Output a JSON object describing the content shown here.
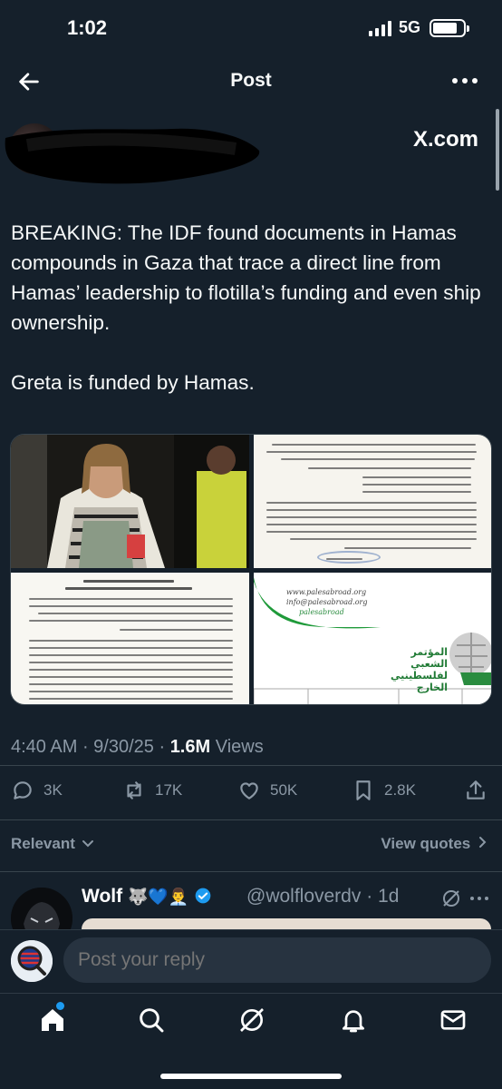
{
  "status_bar": {
    "time": "1:02",
    "network": "5G"
  },
  "header": {
    "title": "Post"
  },
  "post": {
    "source": "X.com",
    "text": "BREAKING: The IDF found documents in Hamas compounds in Gaza that trace a direct line from Hamas’ leadership to flotilla’s funding and even ship ownership.\n\nGreta is funded by Hamas.",
    "media": {
      "tile4_links": [
        "www.palesabroad.org",
        "info@palesabroad.org",
        "palesabroad"
      ],
      "tile4_title_ar": "المؤتمر الشعبي لفلسطينيي الخارج"
    },
    "time": "4:40 AM",
    "date": "9/30/25",
    "views_count": "1.6M",
    "views_label": "Views"
  },
  "actions": {
    "replies": "3K",
    "reposts": "17K",
    "likes": "50K",
    "bookmarks": "2.8K"
  },
  "sort": {
    "label": "Relevant",
    "view_quotes": "View quotes"
  },
  "reply_preview": {
    "name": "Wolf",
    "emoji": "🐺💙👨‍💼",
    "handle": "@wolfloverdv",
    "age": "1d"
  },
  "compose": {
    "placeholder": "Post your reply"
  },
  "colors": {
    "background": "#15202b",
    "accent": "#1d9bf0",
    "muted": "#8b98a5"
  }
}
